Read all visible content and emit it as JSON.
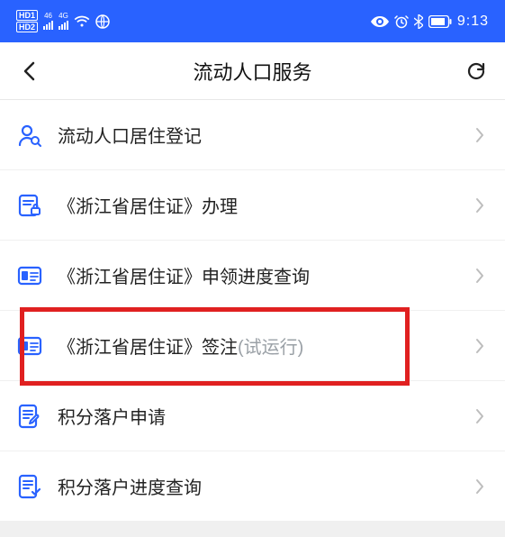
{
  "status_bar": {
    "hd1": "HD1",
    "hd2": "HD2",
    "sig1_label": "46",
    "sig2_label": "4G",
    "time": "9:13"
  },
  "header": {
    "title": "流动人口服务"
  },
  "items": [
    {
      "icon": "person-search-icon",
      "label": "流动人口居住登记",
      "hint": "",
      "highlighted": false
    },
    {
      "icon": "document-lock-icon",
      "label": "《浙江省居住证》办理",
      "hint": "",
      "highlighted": false
    },
    {
      "icon": "id-card-icon",
      "label": "《浙江省居住证》申领进度查询",
      "hint": "",
      "highlighted": false
    },
    {
      "icon": "id-card-icon",
      "label": "《浙江省居住证》签注",
      "hint": "(试运行)",
      "highlighted": true
    },
    {
      "icon": "form-edit-icon",
      "label": "积分落户申请",
      "hint": "",
      "highlighted": false
    },
    {
      "icon": "form-check-icon",
      "label": "积分落户进度查询",
      "hint": "",
      "highlighted": false
    }
  ],
  "colors": {
    "primary": "#2962ff",
    "highlight_border": "#e02020",
    "hint": "#9aa0a6"
  }
}
